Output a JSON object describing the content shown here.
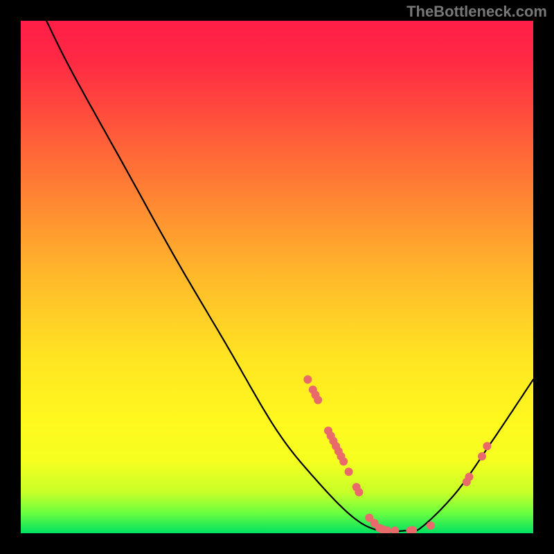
{
  "watermark": "TheBottleneck.com",
  "chart_data": {
    "type": "line",
    "title": "",
    "xlabel": "",
    "ylabel": "",
    "xlim": [
      0,
      100
    ],
    "ylim": [
      0,
      100
    ],
    "curve": [
      {
        "x": 5,
        "y": 100
      },
      {
        "x": 10,
        "y": 90
      },
      {
        "x": 20,
        "y": 72
      },
      {
        "x": 30,
        "y": 54
      },
      {
        "x": 40,
        "y": 37
      },
      {
        "x": 50,
        "y": 20
      },
      {
        "x": 58,
        "y": 10
      },
      {
        "x": 65,
        "y": 3
      },
      {
        "x": 70,
        "y": 0.5
      },
      {
        "x": 75,
        "y": 0.5
      },
      {
        "x": 78,
        "y": 1
      },
      {
        "x": 85,
        "y": 8
      },
      {
        "x": 92,
        "y": 18
      },
      {
        "x": 100,
        "y": 30
      }
    ],
    "highlighted_points": [
      {
        "x": 56,
        "y": 30
      },
      {
        "x": 57,
        "y": 28
      },
      {
        "x": 57.5,
        "y": 27
      },
      {
        "x": 58,
        "y": 26
      },
      {
        "x": 60,
        "y": 20
      },
      {
        "x": 60.5,
        "y": 19
      },
      {
        "x": 61,
        "y": 18
      },
      {
        "x": 61.5,
        "y": 17
      },
      {
        "x": 62,
        "y": 16
      },
      {
        "x": 62.5,
        "y": 15
      },
      {
        "x": 63,
        "y": 14
      },
      {
        "x": 64,
        "y": 12
      },
      {
        "x": 65.5,
        "y": 9
      },
      {
        "x": 66,
        "y": 8
      },
      {
        "x": 68,
        "y": 3
      },
      {
        "x": 69,
        "y": 2
      },
      {
        "x": 70,
        "y": 1
      },
      {
        "x": 70.5,
        "y": 0.8
      },
      {
        "x": 71,
        "y": 0.6
      },
      {
        "x": 71.5,
        "y": 0.5
      },
      {
        "x": 73,
        "y": 0.5
      },
      {
        "x": 76,
        "y": 0.5
      },
      {
        "x": 76.5,
        "y": 0.6
      },
      {
        "x": 80,
        "y": 1.5
      },
      {
        "x": 87,
        "y": 10
      },
      {
        "x": 87.5,
        "y": 11
      },
      {
        "x": 90,
        "y": 15
      },
      {
        "x": 91,
        "y": 17
      }
    ],
    "colors": {
      "curve": "#000000",
      "dots": "#e86a6a",
      "gradient_top": "#ff1e47",
      "gradient_bottom": "#00e060"
    }
  }
}
